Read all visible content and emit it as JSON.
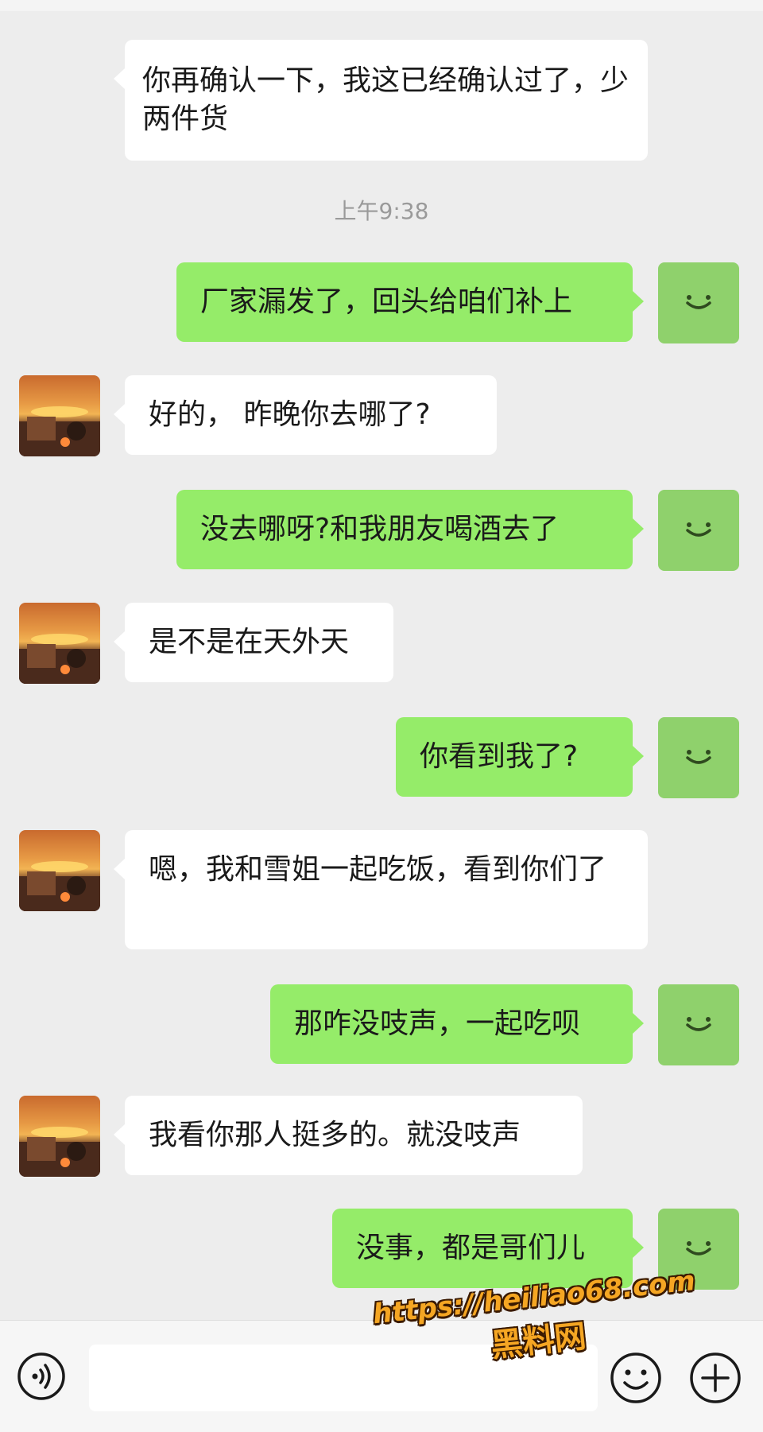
{
  "app": {
    "accent_color": "#95ec69",
    "background_color": "#ededed"
  },
  "timestamp": "上午9:38",
  "messages": [
    {
      "side": "in",
      "text": "你再确认一下，我这已经确认过了，少两件货"
    },
    {
      "side": "out",
      "text": "厂家漏发了，回头给咱们补上"
    },
    {
      "side": "in",
      "text": "好的， 昨晚你去哪了?"
    },
    {
      "side": "out",
      "text": "没去哪呀?和我朋友喝酒去了"
    },
    {
      "side": "in",
      "text": "是不是在天外天"
    },
    {
      "side": "out",
      "text": "你看到我了?"
    },
    {
      "side": "in",
      "text": "嗯，我和雪姐一起吃饭，看到你们了"
    },
    {
      "side": "out",
      "text": "那咋没吱声，一起吃呗"
    },
    {
      "side": "in",
      "text": "我看你那人挺多的。就没吱声"
    },
    {
      "side": "out",
      "text": "没事，都是哥们儿"
    }
  ],
  "input_bar": {
    "voice_icon": "voice-icon",
    "input_value": "",
    "emoji_icon": "emoji-icon",
    "plus_icon": "plus-icon"
  },
  "watermark": {
    "url": "https://heiliao68.com",
    "name": "黑料网"
  }
}
